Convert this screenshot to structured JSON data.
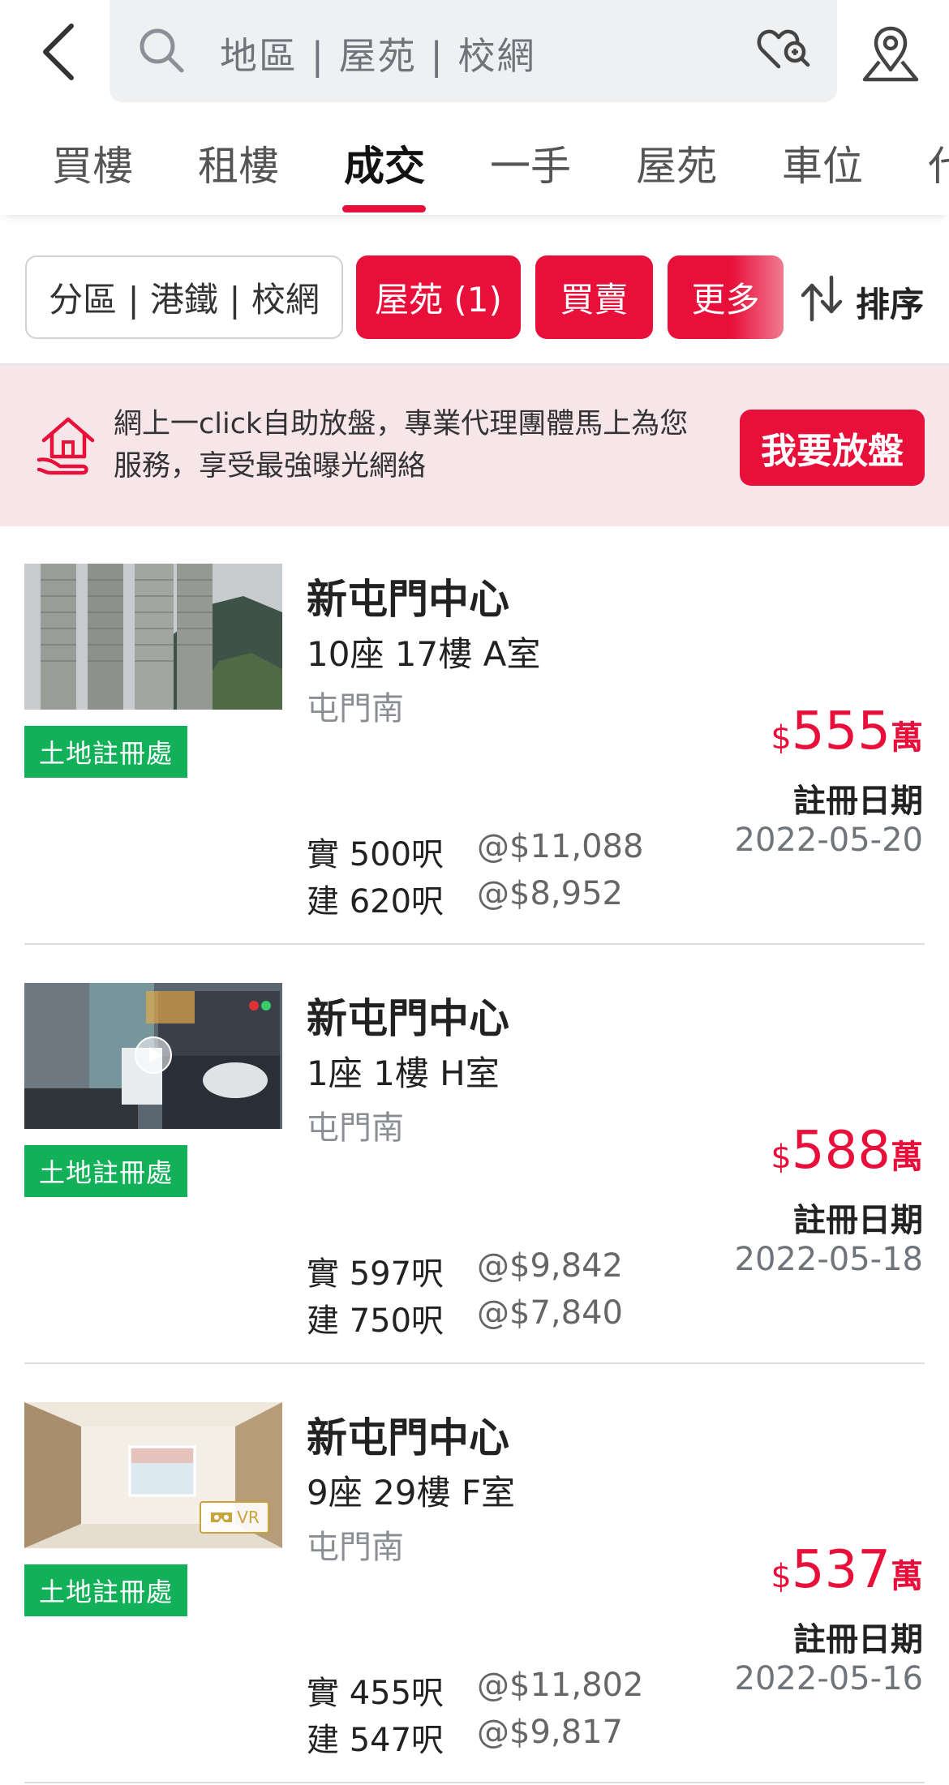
{
  "search": {
    "placeholder": "地區 | 屋苑 | 校網"
  },
  "icons": {
    "back": "chevron-left-icon",
    "search": "search-icon",
    "saved_search": "heart-search-icon",
    "map": "map-pin-icon",
    "sort": "sort-arrows-icon",
    "promo": "house-hand-icon"
  },
  "tabs": [
    {
      "label": "買樓",
      "active": false
    },
    {
      "label": "租樓",
      "active": false
    },
    {
      "label": "成交",
      "active": true
    },
    {
      "label": "一手",
      "active": false
    },
    {
      "label": "屋苑",
      "active": false
    },
    {
      "label": "車位",
      "active": false
    },
    {
      "label": "代",
      "active": false
    }
  ],
  "filters": {
    "district": "分區 | 港鐵 | 校網",
    "estate": "屋苑 (1)",
    "deal_type": "買賣",
    "more": "更多",
    "sort": "排序"
  },
  "promo": {
    "text": "網上一click自助放盤，專業代理團體馬上為您服務，享受最強曝光網絡",
    "button": "我要放盤"
  },
  "colors": {
    "accent": "#e8103a",
    "badge_green": "#13b05a",
    "promo_bg": "#f7e6e9"
  },
  "listings": [
    {
      "badge": "土地註冊處",
      "estate": "新屯門中心",
      "unit": "10座 17樓 A室",
      "district": "屯門南",
      "price_currency": "$",
      "price": "555",
      "price_unit": "萬",
      "saleable_label": "實 500呎",
      "saleable_psf": "@$11,088",
      "gross_label": "建 620呎",
      "gross_psf": "@$8,952",
      "reg_label": "註冊日期",
      "reg_date": "2022-05-20",
      "media": "photo"
    },
    {
      "badge": "土地註冊處",
      "estate": "新屯門中心",
      "unit": "1座 1樓 H室",
      "district": "屯門南",
      "price_currency": "$",
      "price": "588",
      "price_unit": "萬",
      "saleable_label": "實 597呎",
      "saleable_psf": "@$9,842",
      "gross_label": "建 750呎",
      "gross_psf": "@$7,840",
      "reg_label": "註冊日期",
      "reg_date": "2022-05-18",
      "media": "video"
    },
    {
      "badge": "土地註冊處",
      "estate": "新屯門中心",
      "unit": "9座 29樓 F室",
      "district": "屯門南",
      "price_currency": "$",
      "price": "537",
      "price_unit": "萬",
      "saleable_label": "實 455呎",
      "saleable_psf": "@$11,802",
      "gross_label": "建 547呎",
      "gross_psf": "@$9,817",
      "reg_label": "註冊日期",
      "reg_date": "2022-05-16",
      "media": "vr",
      "media_label": "VR"
    }
  ]
}
